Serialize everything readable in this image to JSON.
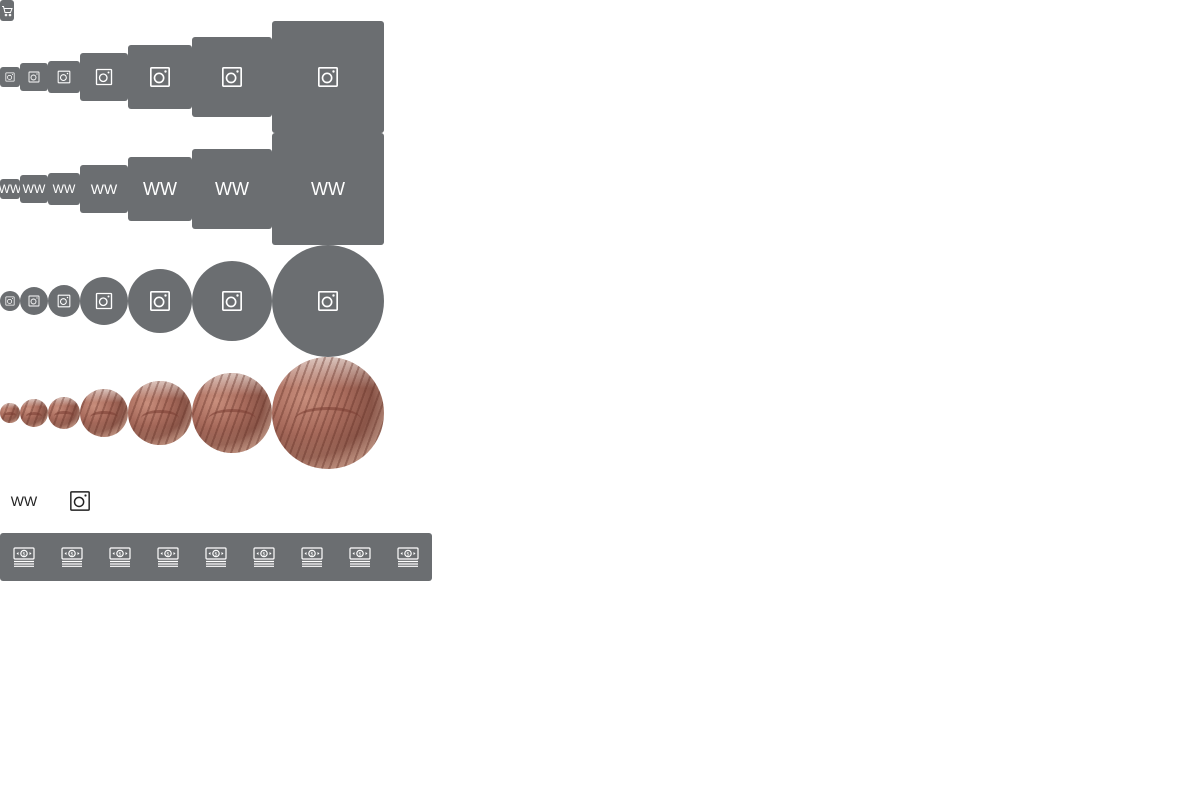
{
  "cart": {
    "icon": "shopping-cart-icon"
  },
  "square_avatars": {
    "icon": "instagram-icon"
  },
  "text_avatars": {
    "initials": "WW"
  },
  "circle_avatars": {
    "icon": "instagram-icon"
  },
  "photo_avatars": {
    "image": "red-rock-canyon-photo"
  },
  "plain_row": {
    "initials": "WW",
    "icon": "instagram-icon"
  },
  "bill_buttons": {
    "icon": "money-bill-icon",
    "count": 9
  },
  "colors": {
    "avatar_bg": "#6b6e71",
    "avatar_fg": "#ffffff"
  }
}
